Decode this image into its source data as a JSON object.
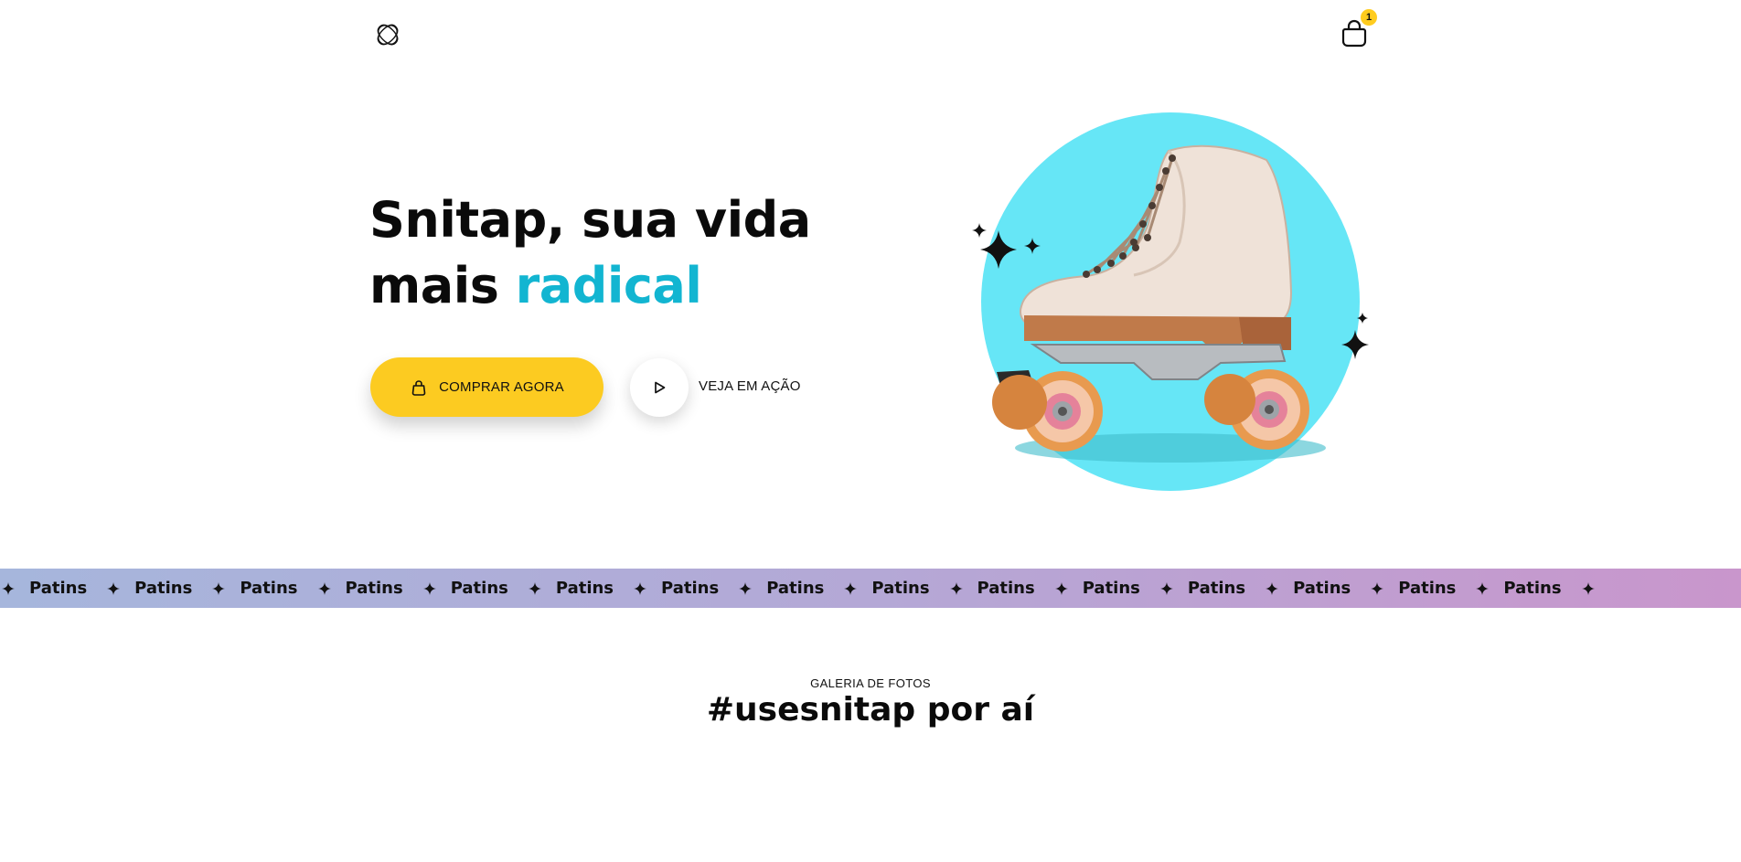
{
  "header": {
    "logo_icon": "knot-logo-icon",
    "cart_icon": "shopping-bag-icon",
    "cart_count": "1"
  },
  "hero": {
    "title_line1": "Snitap, sua vida",
    "title_line2_plain": "mais ",
    "title_line2_accent": "radical",
    "buy_label": "COMPRAR AGORA",
    "buy_icon": "shopping-bag-icon",
    "play_icon": "play-icon",
    "play_label": "VEJA EM AÇÃO",
    "image_subject": "roller-skate",
    "accent_color": "#12b5d1",
    "button_color": "#fccb21",
    "circle_color": "#66e6f6"
  },
  "marquee": {
    "items": [
      "Patins",
      "Patins",
      "Patins",
      "Patins",
      "Patins",
      "Patins",
      "Patins",
      "Patins",
      "Patins",
      "Patins",
      "Patins",
      "Patins",
      "Patins",
      "Patins",
      "Patins"
    ],
    "separator_icon": "four-point-star-icon"
  },
  "gallery": {
    "eyebrow": "GALERIA DE FOTOS",
    "title": "#usesnitap por aí"
  }
}
